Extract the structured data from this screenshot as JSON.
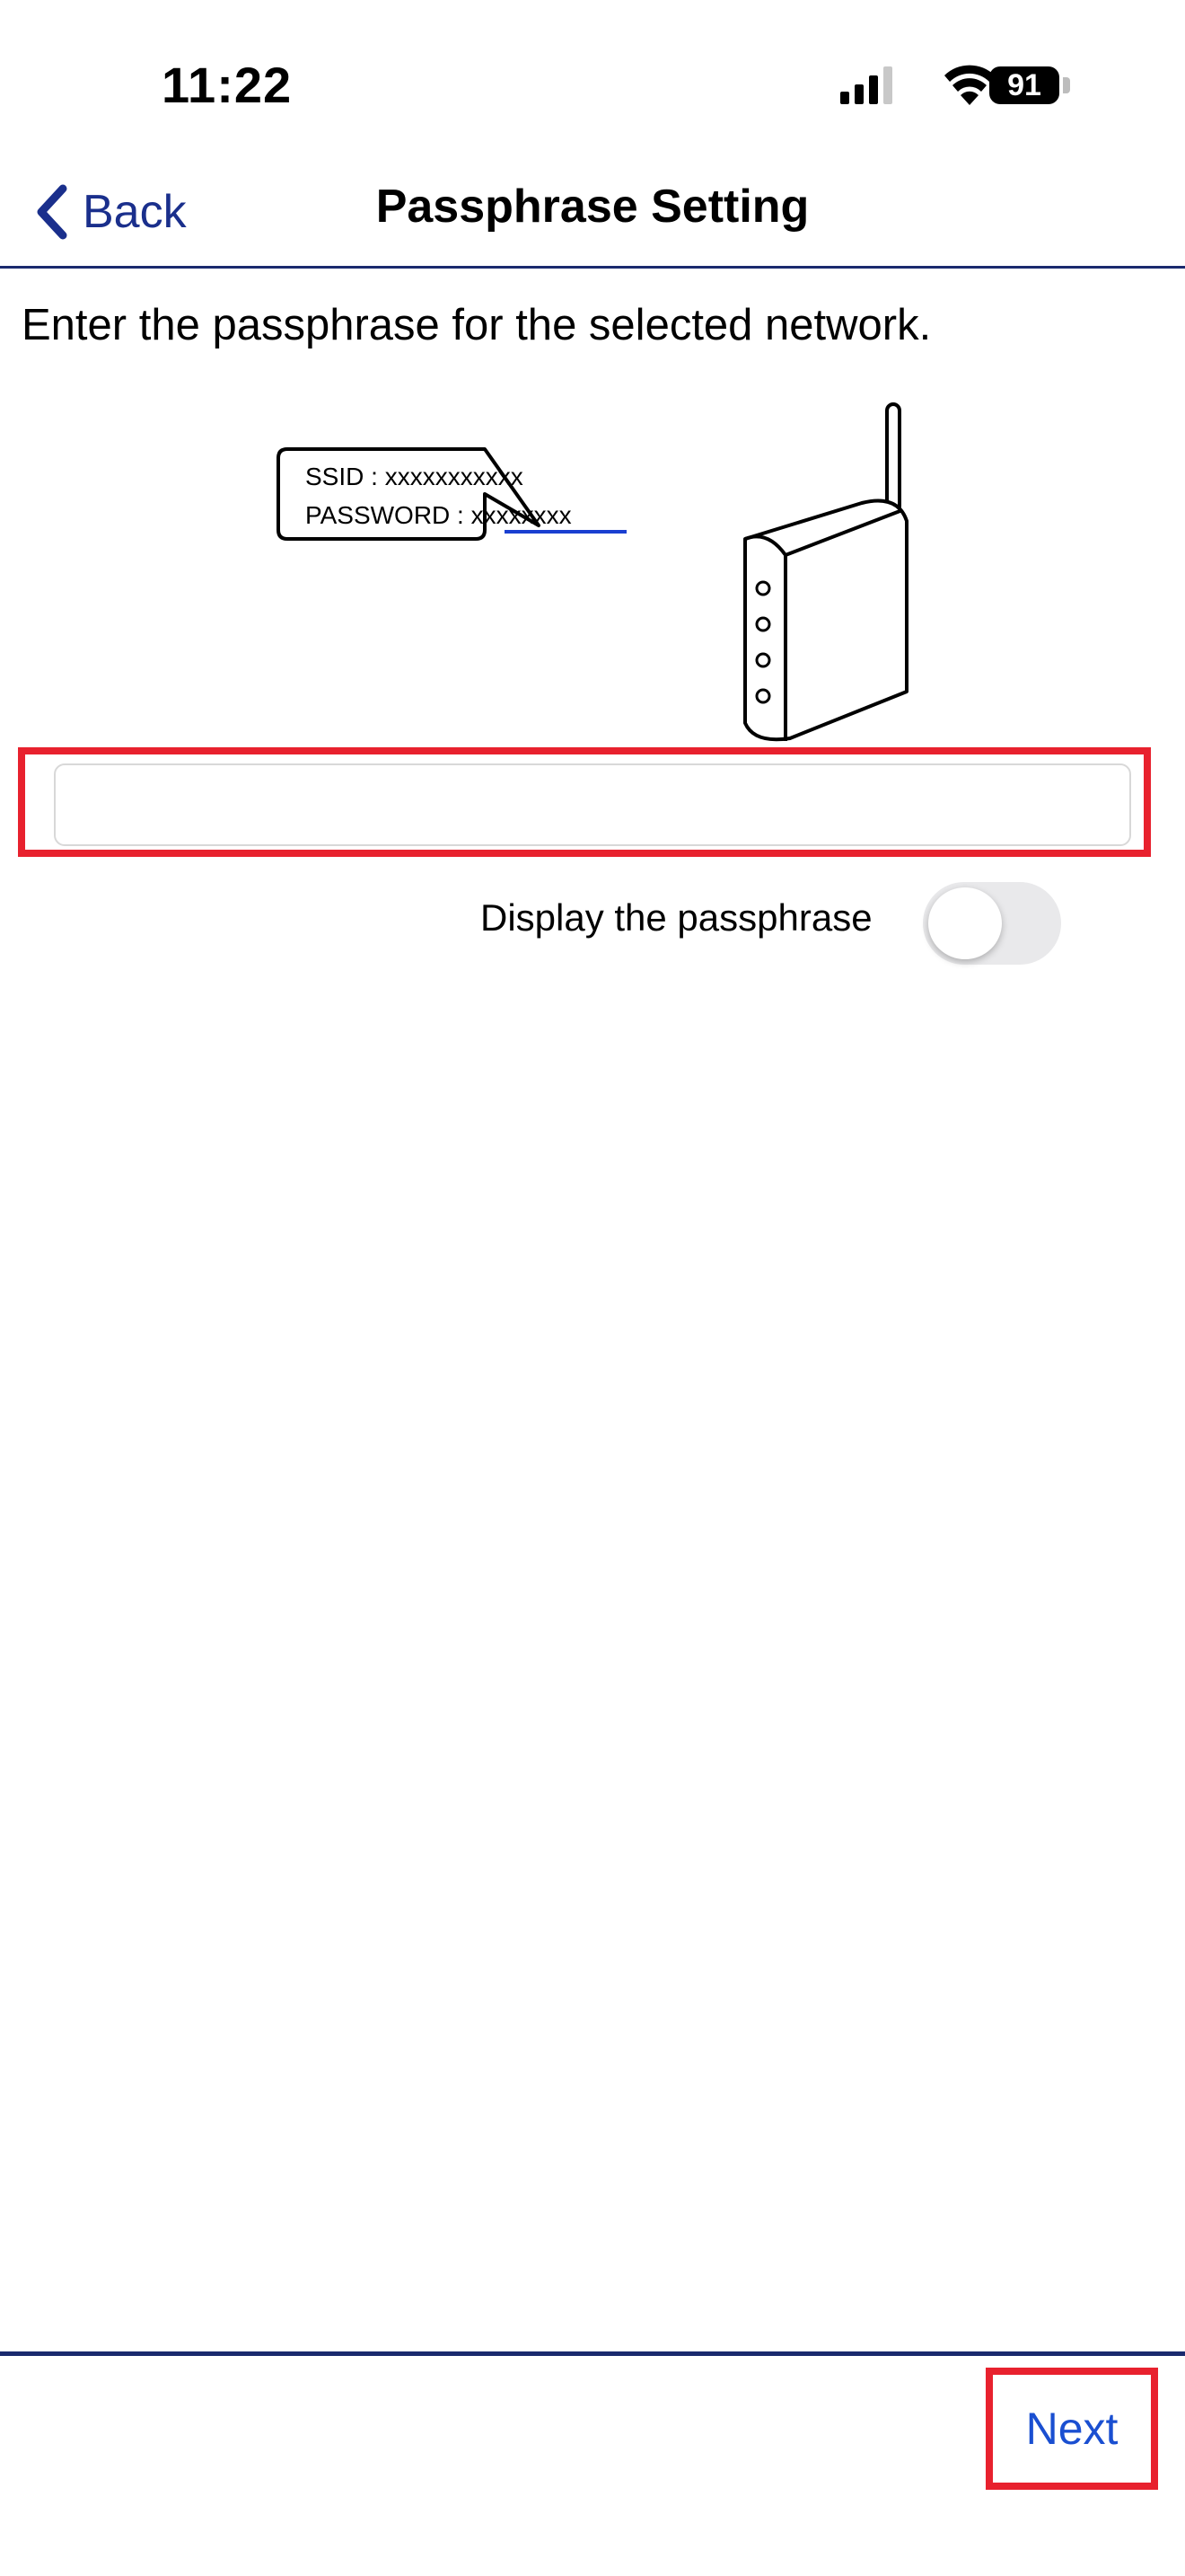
{
  "status_bar": {
    "time": "11:22",
    "battery": "91",
    "icons": [
      "cellular-signal-icon",
      "wifi-icon",
      "battery-icon"
    ]
  },
  "nav": {
    "back_label": "Back",
    "title": "Passphrase Setting",
    "accent_color": "#1a2f8c"
  },
  "main": {
    "instruction": "Enter the passphrase for the selected network.",
    "illustration": {
      "ssid_line": "SSID : xxxxxxxxxxx",
      "password_prefix": "PASSWORD : ",
      "password_value": "xxxxxxxx",
      "icon": "router-icon"
    },
    "passphrase_input": {
      "value": "",
      "placeholder": ""
    },
    "display_toggle": {
      "label": "Display the passphrase",
      "on": false
    }
  },
  "footer": {
    "next_label": "Next",
    "highlight_color": "#e8212e"
  }
}
